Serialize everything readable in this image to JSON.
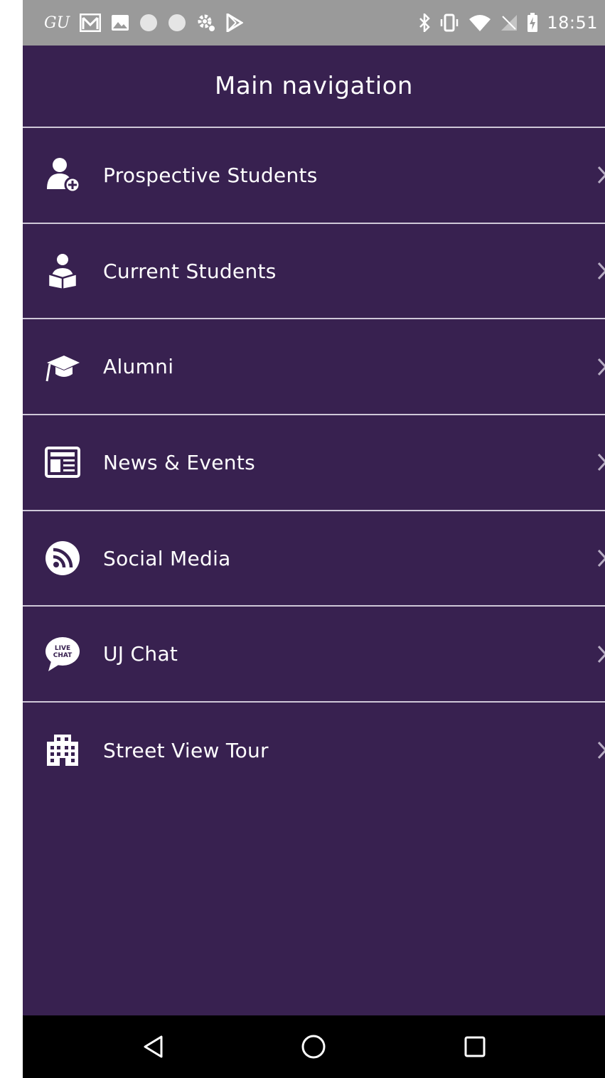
{
  "status_bar": {
    "carrier_label": "GU",
    "time": "18:51",
    "left_icons": [
      "gmail-icon",
      "image-icon",
      "circle-icon",
      "circle-icon",
      "settings-gear-icon",
      "play-store-icon"
    ],
    "right_icons": [
      "bluetooth-icon",
      "vibrate-icon",
      "wifi-icon",
      "no-signal-icon",
      "battery-charging-icon"
    ]
  },
  "header": {
    "title": "Main navigation"
  },
  "nav": {
    "items": [
      {
        "label": "Prospective Students",
        "icon": "add-user-icon"
      },
      {
        "label": "Current Students",
        "icon": "student-reading-icon"
      },
      {
        "label": "Alumni",
        "icon": "graduation-cap-icon"
      },
      {
        "label": "News & Events",
        "icon": "newspaper-icon"
      },
      {
        "label": "Social Media",
        "icon": "rss-icon"
      },
      {
        "label": "UJ Chat",
        "icon": "live-chat-icon",
        "icon_text_top": "LIVE",
        "icon_text_bottom": "CHAT"
      },
      {
        "label": "Street View Tour",
        "icon": "building-icon"
      }
    ]
  },
  "system_nav": [
    "back-icon",
    "home-icon",
    "recents-icon"
  ],
  "colors": {
    "background": "#382150",
    "divider": "#cfc8d8",
    "status_bar": "#9a9a9a",
    "text": "#ffffff",
    "chevron": "#b8aec4"
  }
}
